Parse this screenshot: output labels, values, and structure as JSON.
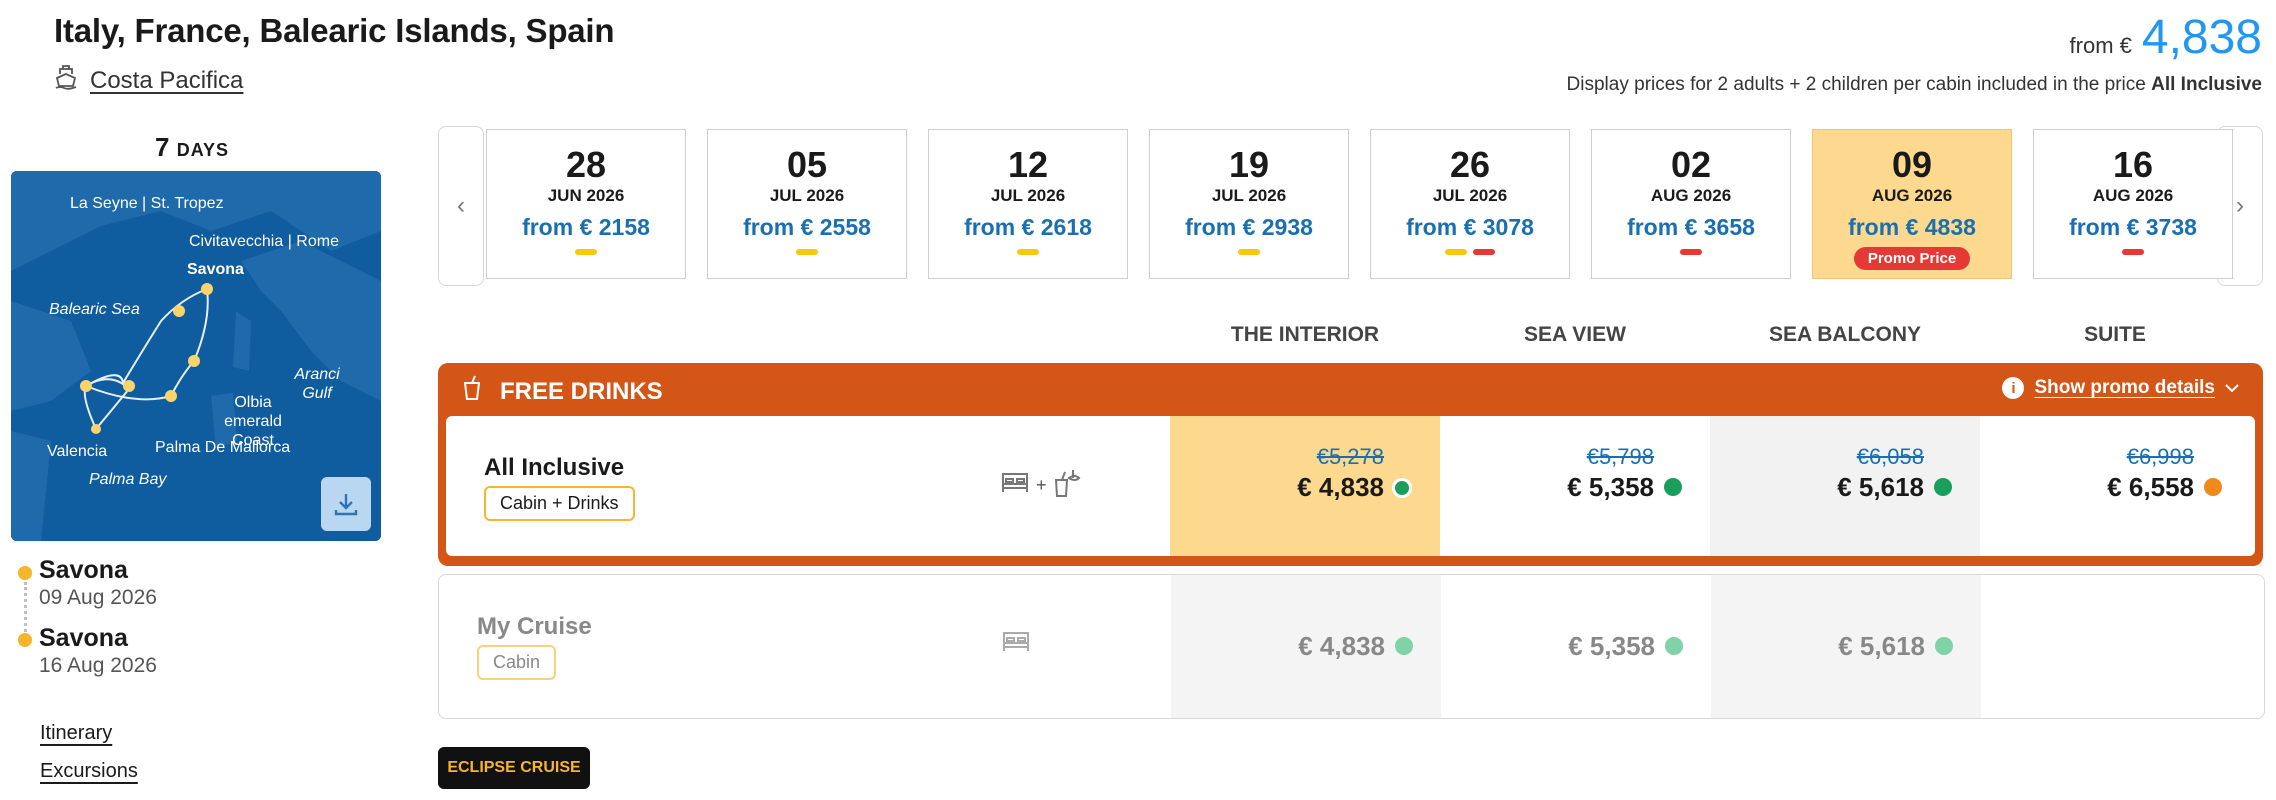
{
  "header": {
    "title": "Italy, France, Balearic Islands, Spain",
    "ship": "Costa Pacifica",
    "from_label": "from €",
    "from_price": "4,838",
    "note_prefix": "Display prices for 2 adults + 2 children per cabin included in the price",
    "note_bold": "All Inclusive"
  },
  "side": {
    "days_num": "7",
    "days_label": "DAYS",
    "map_labels": [
      "La Seyne | St. Tropez",
      "Civitavecchia | Rome",
      "Savona",
      "Balearic Sea",
      "Aranci Gulf",
      "Olbia emerald Coast",
      "Palma De Mallorca",
      "Valencia",
      "Palma Bay"
    ],
    "from_port": "Savona",
    "from_date": "09 Aug 2026",
    "to_port": "Savona",
    "to_date": "16 Aug 2026",
    "links": [
      "Itinerary",
      "Excursions"
    ]
  },
  "dates": [
    {
      "day": "28",
      "month": "JUN 2026",
      "price": "from € 2158",
      "bars": [
        "#f6c90e"
      ],
      "promo": ""
    },
    {
      "day": "05",
      "month": "JUL 2026",
      "price": "from € 2558",
      "bars": [
        "#f6c90e"
      ],
      "promo": ""
    },
    {
      "day": "12",
      "month": "JUL 2026",
      "price": "from € 2618",
      "bars": [
        "#f6c90e"
      ],
      "promo": ""
    },
    {
      "day": "19",
      "month": "JUL 2026",
      "price": "from € 2938",
      "bars": [
        "#f6c90e"
      ],
      "promo": ""
    },
    {
      "day": "26",
      "month": "JUL 2026",
      "price": "from € 3078",
      "bars": [
        "#f6c90e",
        "#e53935"
      ],
      "promo": ""
    },
    {
      "day": "02",
      "month": "AUG 2026",
      "price": "from € 3658",
      "bars": [
        "#e53935"
      ],
      "promo": ""
    },
    {
      "day": "09",
      "month": "AUG 2026",
      "price": "from € 4838",
      "bars": [],
      "promo": "Promo Price"
    },
    {
      "day": "16",
      "month": "AUG 2026",
      "price": "from € 3738",
      "bars": [
        "#e53935"
      ],
      "promo": ""
    }
  ],
  "columns": [
    "THE INTERIOR",
    "SEA VIEW",
    "SEA BALCONY",
    "SUITE"
  ],
  "promo": {
    "title": "FREE DRINKS",
    "link": "Show promo details"
  },
  "rows": [
    {
      "name": "All Inclusive",
      "badge": "Cabin + Drinks",
      "cells": [
        {
          "old": "€5,278",
          "new": "€ 4,838",
          "dot": "#1a9e5c"
        },
        {
          "old": "€5,798",
          "new": "€ 5,358",
          "dot": "#1a9e5c"
        },
        {
          "old": "€6,058",
          "new": "€ 5,618",
          "dot": "#1a9e5c"
        },
        {
          "old": "€6,998",
          "new": "€ 6,558",
          "dot": "#f08a1c"
        }
      ]
    },
    {
      "name": "My Cruise",
      "badge": "Cabin",
      "cells": [
        {
          "new": "€ 4,838",
          "dot": "#7fd3a7"
        },
        {
          "new": "€ 5,358",
          "dot": "#7fd3a7"
        },
        {
          "new": "€ 5,618",
          "dot": "#7fd3a7"
        }
      ]
    }
  ],
  "badge_bottom": "ECLIPSE CRUISE"
}
